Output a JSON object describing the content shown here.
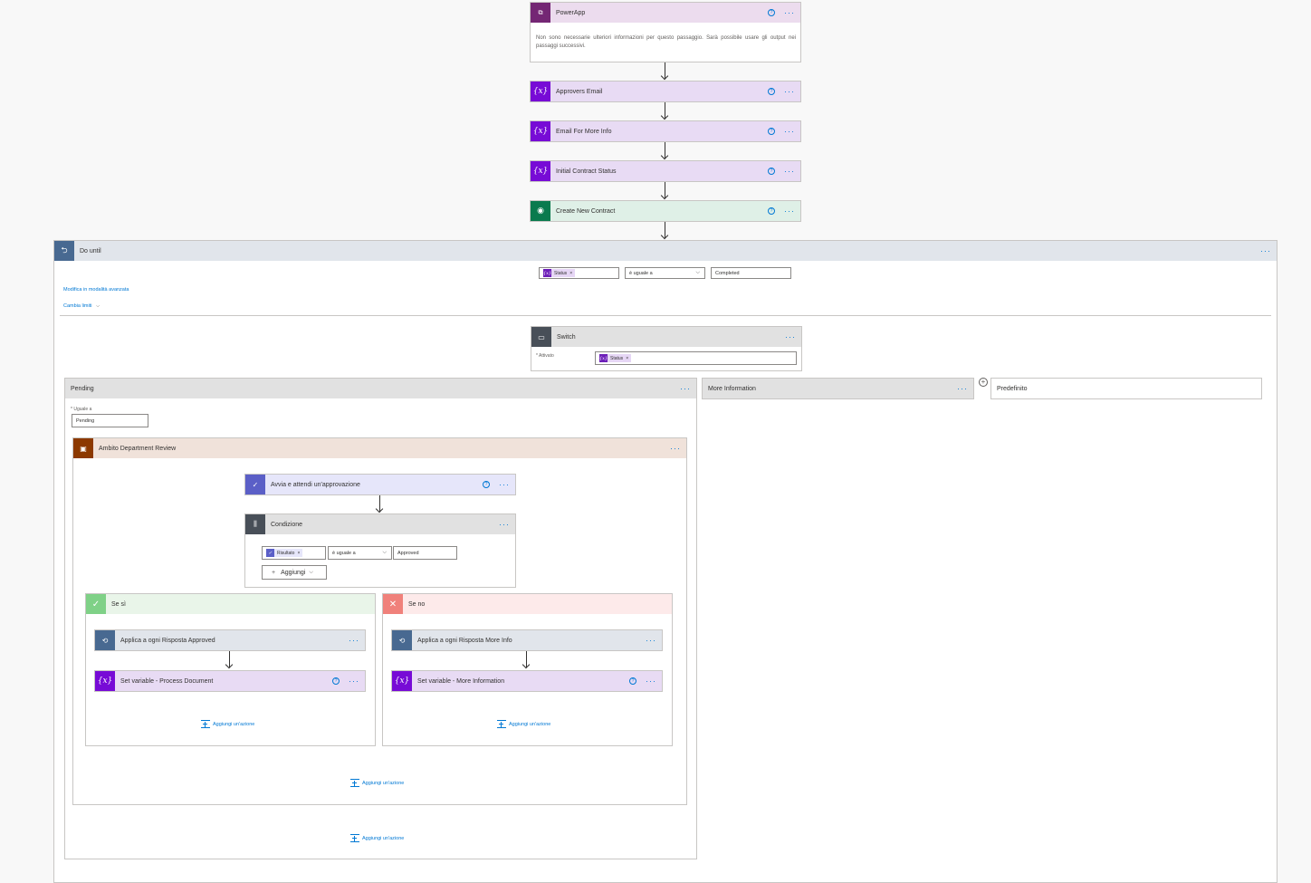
{
  "colors": {
    "powerapp": "#742774",
    "variable": "#770bd6",
    "varbg": "#e8dbf4",
    "dataverse": "#0a7a4e",
    "dvbg": "#dff0e7",
    "loop": "#486991",
    "approval": "#5b5fc7",
    "apbg": "#e6e6fa",
    "scope": "#8c3900",
    "scopebg": "#f0e2da",
    "condition": "#484f58"
  },
  "powerapp": {
    "title": "PowerApp",
    "body": "Non sono necessarie ulteriori informazioni per questo passaggio. Sarà possibile usare gli output nei passaggi successivi."
  },
  "steps": [
    {
      "title": "Approvers Email"
    },
    {
      "title": "Email For More Info"
    },
    {
      "title": "Initial Contract Status"
    },
    {
      "title": "Create New Contract"
    }
  ],
  "dountil": {
    "title": "Do until",
    "token": "Status",
    "operator": "è uguale a",
    "value": "Completed",
    "advanced_link": "Modifica in modalità avanzata",
    "limits_link": "Cambia limiti"
  },
  "switch": {
    "title": "Switch",
    "label": "* Attivato",
    "token": "Status"
  },
  "cases": {
    "pending": {
      "title": "Pending",
      "equals_label": "* Uguale a",
      "equals_value": "Pending"
    },
    "moreinfo": {
      "title": "More Information"
    },
    "default": {
      "title": "Predefinito"
    }
  },
  "scope": {
    "title": "Ambito Department Review"
  },
  "approval": {
    "title": "Avvia e attendi un'approvazione"
  },
  "condition": {
    "title": "Condizione",
    "token": "Risultato",
    "operator": "è uguale a",
    "value": "Approved",
    "add_label": "Aggiungi"
  },
  "branches": {
    "yes": {
      "title": "Se sì",
      "loop": "Applica a ogni Risposta Approved",
      "setvar": "Set variable - Process Document"
    },
    "no": {
      "title": "Se no",
      "loop": "Applica a ogni Risposta More Info",
      "setvar": "Set variable - More Information"
    }
  },
  "add_action_label": "Aggiungi un'azione"
}
